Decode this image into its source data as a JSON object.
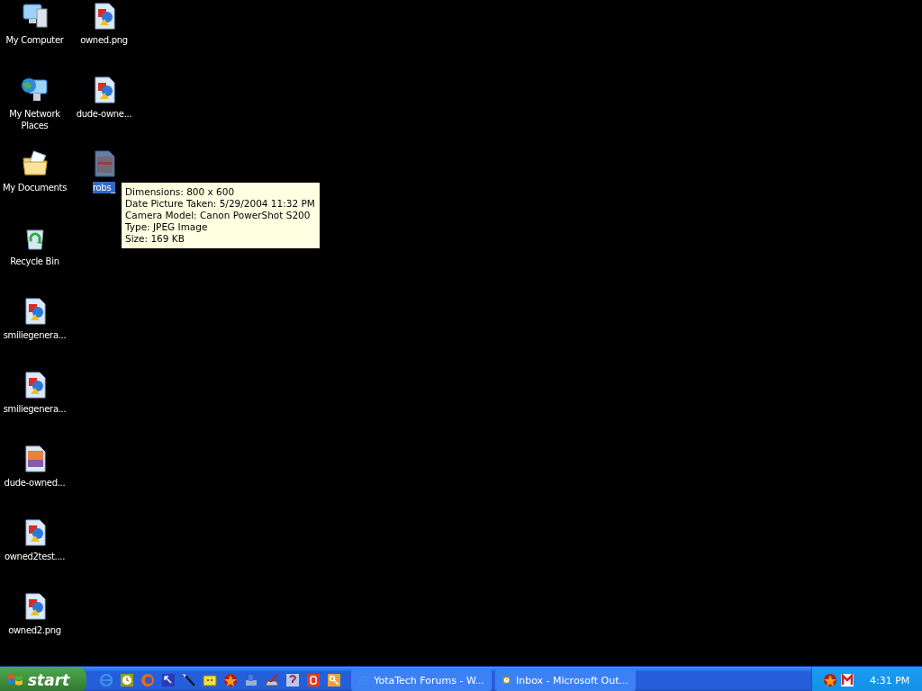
{
  "desktop": {
    "icons": [
      {
        "label": "My Computer",
        "kind": "computer",
        "selected": false
      },
      {
        "label": "My Network Places",
        "kind": "network",
        "selected": false
      },
      {
        "label": "My Documents",
        "kind": "documents",
        "selected": false
      },
      {
        "label": "Recycle Bin",
        "kind": "recycle",
        "selected": false
      },
      {
        "label": "smiliegenera...",
        "kind": "png",
        "selected": false
      },
      {
        "label": "smiliegenera...",
        "kind": "png",
        "selected": false
      },
      {
        "label": "dude-owned...",
        "kind": "photo",
        "selected": false
      },
      {
        "label": "owned2test....",
        "kind": "png",
        "selected": false
      },
      {
        "label": "owned2.png",
        "kind": "png",
        "selected": false
      },
      {
        "label": "owned.png",
        "kind": "png",
        "selected": false
      },
      {
        "label": "dude-owne...",
        "kind": "png",
        "selected": false
      },
      {
        "label": "robs_",
        "kind": "jpeg",
        "selected": true
      }
    ]
  },
  "tooltip": {
    "lines": [
      "Dimensions: 800 x 600",
      "Date Picture Taken: 5/29/2004 11:32 PM",
      "Camera Model: Canon PowerShot S200",
      "Type: JPEG Image",
      "Size: 169 KB"
    ]
  },
  "taskbar": {
    "start": "start",
    "quick_launch": [
      {
        "kind": "browser"
      },
      {
        "kind": "mail"
      },
      {
        "kind": "firefox"
      },
      {
        "kind": "resize"
      },
      {
        "kind": "wand"
      },
      {
        "kind": "folder"
      },
      {
        "kind": "badge"
      },
      {
        "kind": "printer"
      },
      {
        "kind": "scanner"
      },
      {
        "kind": "help"
      },
      {
        "kind": "power"
      },
      {
        "kind": "key"
      }
    ],
    "tasks": [
      {
        "label": "YotaTech Forums - W...",
        "kind": "browser",
        "selected": false
      },
      {
        "label": "Inbox - Microsoft Out...",
        "kind": "mail",
        "selected": false
      }
    ],
    "tray": {
      "icons": [
        {
          "kind": "badge"
        },
        {
          "kind": "gmail"
        }
      ],
      "clock": "4:31 PM"
    }
  }
}
